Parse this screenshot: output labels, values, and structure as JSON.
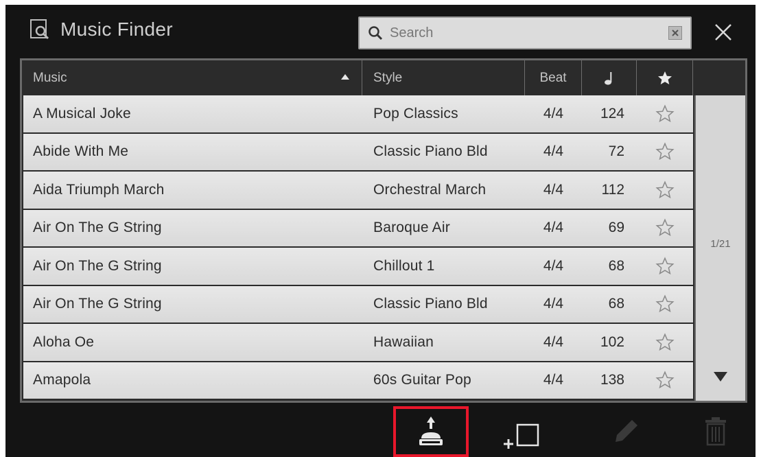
{
  "header": {
    "title": "Music Finder",
    "search_placeholder": "Search"
  },
  "table": {
    "columns": {
      "music": "Music",
      "style": "Style",
      "beat": "Beat",
      "tempo_icon": "quarter-note-icon",
      "favorite_icon": "star-icon"
    },
    "rows": [
      {
        "music": "A Musical Joke",
        "style": "Pop Classics",
        "beat": "4/4",
        "tempo": "124"
      },
      {
        "music": "Abide With Me",
        "style": "Classic Piano Bld",
        "beat": "4/4",
        "tempo": "72"
      },
      {
        "music": "Aida Triumph March",
        "style": "Orchestral March",
        "beat": "4/4",
        "tempo": "112"
      },
      {
        "music": "Air On The G String",
        "style": "Baroque Air",
        "beat": "4/4",
        "tempo": "69"
      },
      {
        "music": "Air On The G String",
        "style": "Chillout 1",
        "beat": "4/4",
        "tempo": "68"
      },
      {
        "music": "Air On The G String",
        "style": "Classic Piano Bld",
        "beat": "4/4",
        "tempo": "68"
      },
      {
        "music": "Aloha Oe",
        "style": "Hawaiian",
        "beat": "4/4",
        "tempo": "102"
      },
      {
        "music": "Amapola",
        "style": "60s Guitar Pop",
        "beat": "4/4",
        "tempo": "138"
      }
    ],
    "page_indicator": "1/21"
  },
  "toolbar": {
    "icons": [
      "export-icon",
      "add-icon",
      "edit-icon",
      "delete-icon"
    ]
  },
  "colors": {
    "background": "#141414",
    "row": "#dedede",
    "highlight": "#e8172b"
  }
}
